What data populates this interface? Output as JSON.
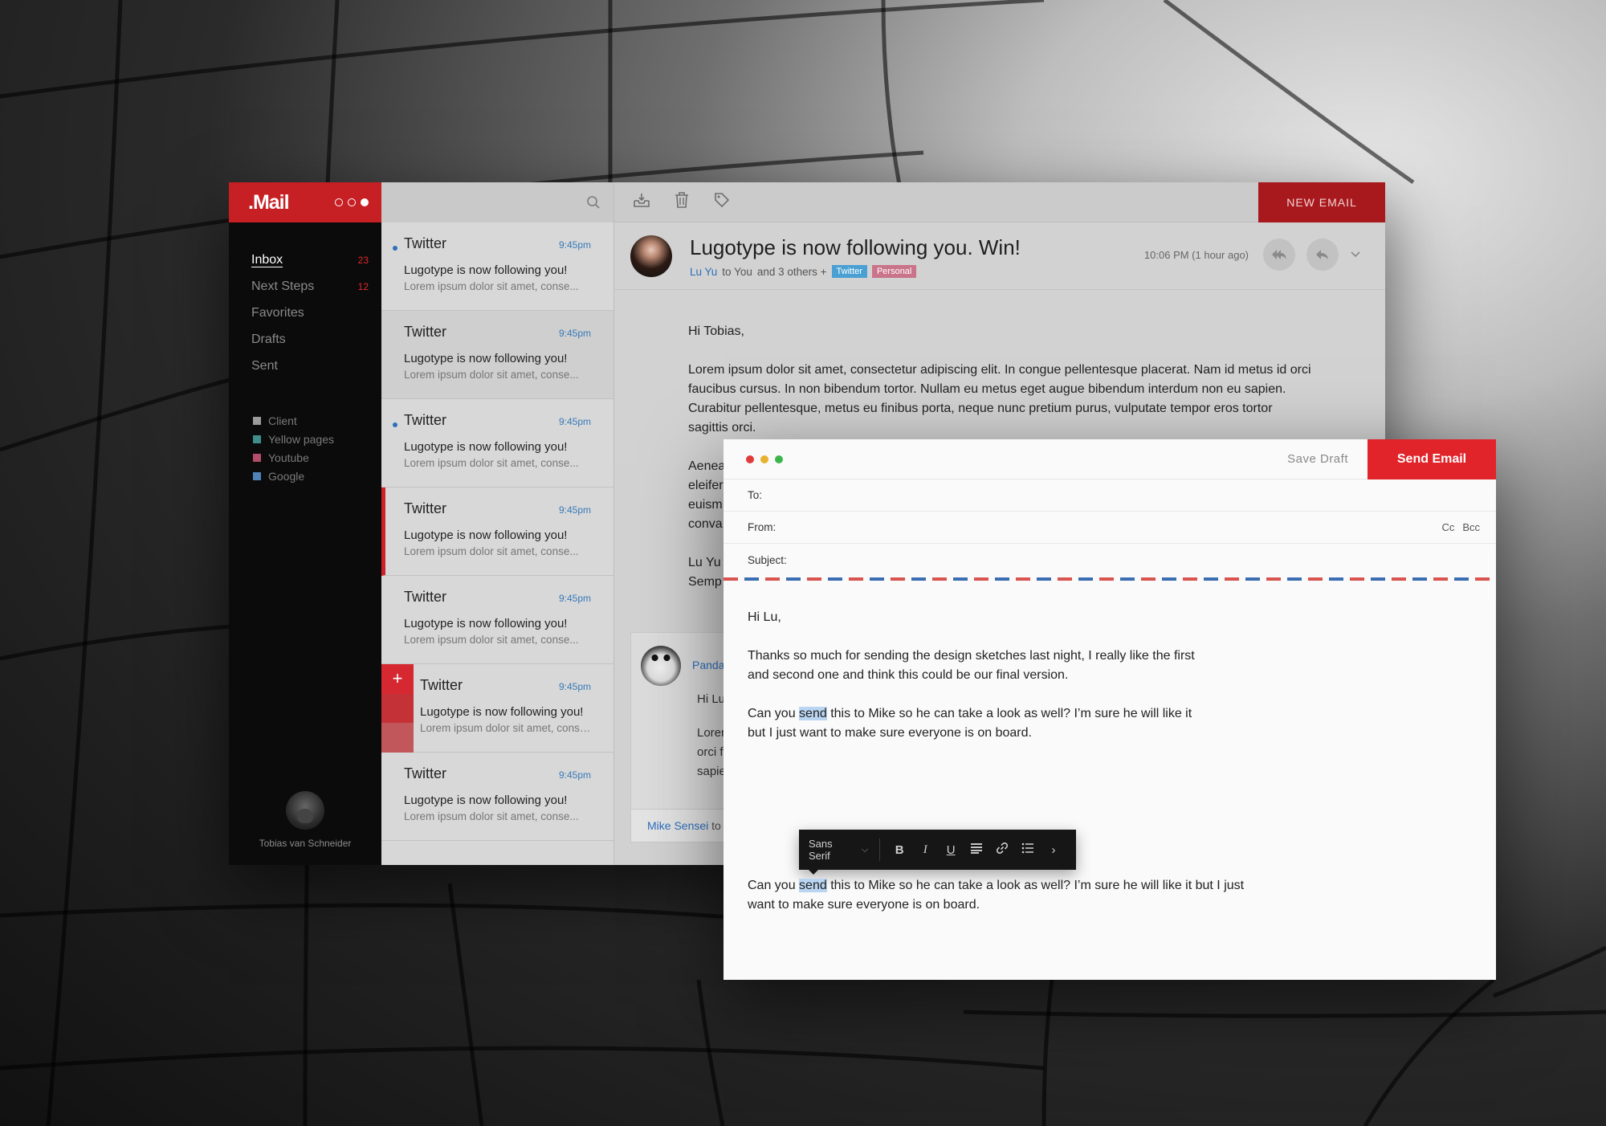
{
  "app": {
    "brand": ".Mail",
    "new_email_label": "NEW EMAIL"
  },
  "sidebar": {
    "items": [
      {
        "label": "Inbox",
        "count": "23"
      },
      {
        "label": "Next Steps",
        "count": "12"
      },
      {
        "label": "Favorites",
        "count": ""
      },
      {
        "label": "Drafts",
        "count": ""
      },
      {
        "label": "Sent",
        "count": ""
      }
    ],
    "labels": [
      {
        "label": "Client",
        "color": "#9b9b9b"
      },
      {
        "label": "Yellow pages",
        "color": "#3f8d8d"
      },
      {
        "label": "Youtube",
        "color": "#b34d6a"
      },
      {
        "label": "Google",
        "color": "#4f83b8"
      }
    ],
    "user_name": "Tobias van Schneider"
  },
  "messages": [
    {
      "from": "Twitter",
      "time": "9:45pm",
      "subject": "Lugotype is now following you!",
      "preview": "Lorem ipsum dolor sit amet, conse..."
    },
    {
      "from": "Twitter",
      "time": "9:45pm",
      "subject": "Lugotype is now following you!",
      "preview": "Lorem ipsum dolor sit amet, conse..."
    },
    {
      "from": "Twitter",
      "time": "9:45pm",
      "subject": "Lugotype is now following you!",
      "preview": "Lorem ipsum dolor sit amet, conse..."
    },
    {
      "from": "Twitter",
      "time": "9:45pm",
      "subject": "Lugotype is now following you!",
      "preview": "Lorem ipsum dolor sit amet, conse..."
    },
    {
      "from": "Twitter",
      "time": "9:45pm",
      "subject": "Lugotype is now following you!",
      "preview": "Lorem ipsum dolor sit amet, conse..."
    },
    {
      "from": "Twitter",
      "time": "9:45pm",
      "subject": "Lugotype is now following you!",
      "preview": "Lorem ipsum dolor sit amet, conse..."
    },
    {
      "from": "Twitter",
      "time": "9:45pm",
      "subject": "Lugotype is now following you!",
      "preview": "Lorem ipsum dolor sit amet, conse..."
    }
  ],
  "swipe_icon": "+",
  "reading": {
    "title": "Lugotype is now following you. Win!",
    "sender": "Lu Yu",
    "to_text": "to You",
    "others": "and 3 others +",
    "tags": [
      "Twitter",
      "Personal"
    ],
    "time": "10:06 PM (1 hour ago)",
    "greeting": "Hi Tobias,",
    "paragraph1": "Lorem ipsum dolor sit amet, consectetur adipiscing elit. In congue pellentesque placerat. Nam id metus id orci faucibus cursus. In non bibendum tortor. Nullam eu metus eget augue bibendum interdum non eu sapien. Curabitur pellentesque, metus eu finibus porta, neque nunc pretium purus, vulputate tempor eros tortor sagittis orci.",
    "paragraph2_start": "Aenea eleifer euism conva",
    "signoff_line1": "Lu Yu",
    "signoff_line2": "Semp",
    "thread_sender": "Panda",
    "thread_greeting": "Hi Lu",
    "thread_line1": "Lorer",
    "thread_line2": "orci f",
    "thread_line3": "sapie",
    "reply_name": "Mike Sensei",
    "reply_suffix": "to"
  },
  "compose": {
    "save_draft": "Save Draft",
    "send": "Send Email",
    "to_label": "To:",
    "from_label": "From:",
    "subject_label": "Subject:",
    "cc": "Cc",
    "bcc": "Bcc",
    "greeting": "Hi Lu,",
    "paragraph1": "Thanks so much for sending the design sketches last night, I really like the first and second one and think this could be our final version.",
    "p2_before": "Can you ",
    "p2_highlight": "send",
    "p2_after": " this to Mike so he can take a look as well? I’m sure he will like it but I just want to make sure everyone is on board.",
    "format_font": "Sans Serif",
    "format_chevron": "⌵",
    "format_bold": "B",
    "format_italic": "I",
    "format_underline": "U",
    "format_more": "›"
  }
}
